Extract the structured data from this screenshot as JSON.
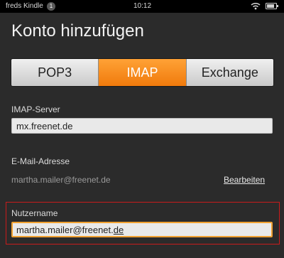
{
  "status_bar": {
    "device_name": "freds Kindle",
    "notification_count": "1",
    "time": "10:12",
    "wifi_icon": "wifi-icon",
    "battery_icon": "battery-icon",
    "battery_level": 0.8
  },
  "page_title": "Konto hinzufügen",
  "tabs": [
    {
      "label": "POP3",
      "active": false
    },
    {
      "label": "IMAP",
      "active": true
    },
    {
      "label": "Exchange",
      "active": false
    }
  ],
  "imap_server": {
    "label": "IMAP-Server",
    "value": "mx.freenet.de"
  },
  "email": {
    "label": "E-Mail-Adresse",
    "value": "martha.mailer@freenet.de",
    "edit_label": "Bearbeiten"
  },
  "username": {
    "label": "Nutzername",
    "value_prefix": "martha.mailer@freenet.",
    "value_suffix": "de"
  },
  "colors": {
    "accent": "#f28a1e",
    "highlight_border": "#c91b1b",
    "background": "#2b2b2b"
  }
}
